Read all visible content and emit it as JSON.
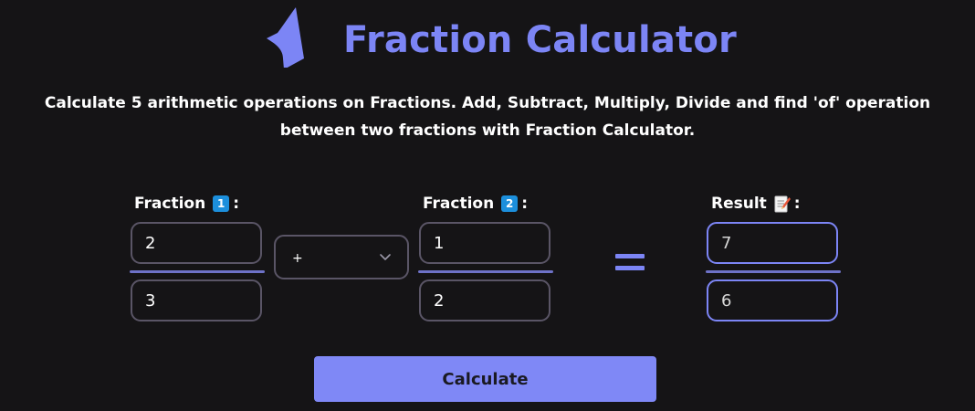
{
  "header": {
    "title": "Fraction Calculator",
    "logo_icon": "star-logo-icon"
  },
  "description": "Calculate 5 arithmetic operations on Fractions. Add, Subtract, Multiply, Divide and find 'of' operation between two fractions with Fraction Calculator.",
  "fraction1": {
    "label": "Fraction",
    "badge": "1",
    "colon": ":",
    "numerator": "2",
    "denominator": "3"
  },
  "operator": {
    "value": "+",
    "icon": "chevron-down-icon"
  },
  "fraction2": {
    "label": "Fraction",
    "badge": "2",
    "colon": ":",
    "numerator": "1",
    "denominator": "2"
  },
  "equals_icon": "equals-icon",
  "result": {
    "label": "Result",
    "icon": "memo-icon",
    "colon": ":",
    "numerator": "7",
    "denominator": "6"
  },
  "calculate_label": "Calculate",
  "colors": {
    "accent": "#7c85f5",
    "background": "#151416",
    "badge": "#1c8fdc",
    "border": "#5a5566"
  }
}
